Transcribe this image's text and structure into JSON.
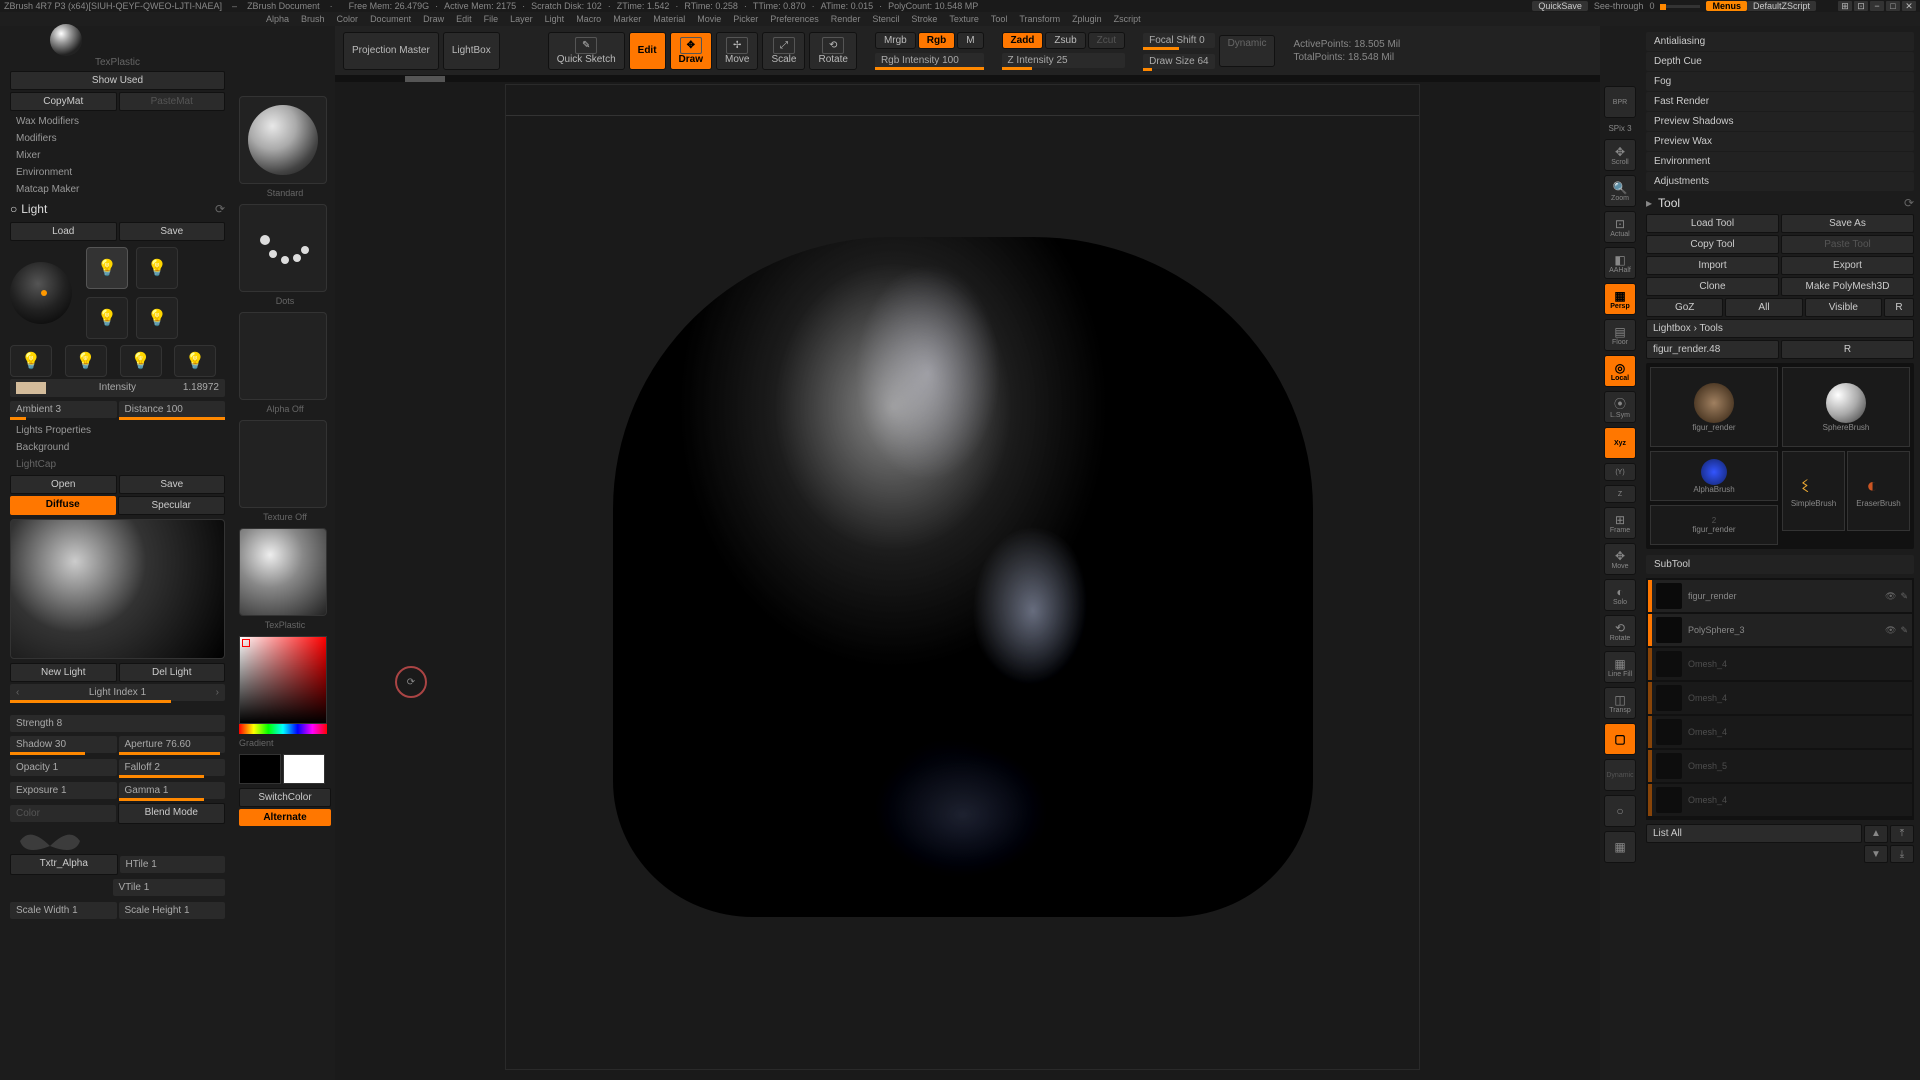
{
  "titlebar": {
    "app": "ZBrush 4R7 P3 (x64)[SIUH-QEYF-QWEO-LJTI-NAEA]",
    "doc": "ZBrush Document",
    "freemem": "Free Mem: 26.479G",
    "activemem": "Active Mem: 2175",
    "scratch": "Scratch Disk: 102",
    "ztime": "ZTime: 1.542",
    "rtime": "RTime: 0.258",
    "ttime": "TTime: 0.870",
    "atime": "ATime: 0.015",
    "polycount": "PolyCount: 10.548 MP",
    "quicksave": "QuickSave",
    "seethrough": "See-through",
    "seethrough_val": "0",
    "menus": "Menus",
    "script": "DefaultZScript"
  },
  "menubar": [
    "Alpha",
    "Brush",
    "Color",
    "Document",
    "Draw",
    "Edit",
    "File",
    "Layer",
    "Light",
    "Macro",
    "Marker",
    "Material",
    "Movie",
    "Picker",
    "Preferences",
    "Render",
    "Stencil",
    "Stroke",
    "Texture",
    "Tool",
    "Transform",
    "Zplugin",
    "Zscript"
  ],
  "left": {
    "texplastic": "TexPlastic",
    "show_used": "Show Used",
    "copymat": "CopyMat",
    "pastemat": "PasteMat",
    "wax": "Wax Modifiers",
    "modifiers": "Modifiers",
    "mixer": "Mixer",
    "environment": "Environment",
    "matcap": "Matcap Maker",
    "light": "Light",
    "load": "Load",
    "save": "Save",
    "intensity_label": "Intensity",
    "intensity_val": "1.18972",
    "ambient": "Ambient 3",
    "distance": "Distance 100",
    "lights_props": "Lights Properties",
    "background": "Background",
    "lightcap": "LightCap",
    "open": "Open",
    "diffuse": "Diffuse",
    "specular": "Specular",
    "new_light": "New Light",
    "del_light": "Del Light",
    "light_index": "Light Index 1",
    "strength": "Strength 8",
    "shadow": "Shadow 30",
    "aperture": "Aperture 76.60",
    "opacity": "Opacity 1",
    "falloff": "Falloff 2",
    "exposure": "Exposure 1",
    "gamma": "Gamma 1",
    "blend": "Blend Mode",
    "txtr_alpha": "Txtr_Alpha",
    "htile": "HTile 1",
    "vtile": "VTile 1",
    "scalew": "Scale Width 1",
    "scaleh": "Scale Height 1"
  },
  "toolcol": {
    "standard": "Standard",
    "dots": "Dots",
    "alpha_off": "Alpha Off",
    "texture_off": "Texture Off",
    "texplastic": "TexPlastic",
    "gradient": "Gradient",
    "switch": "SwitchColor",
    "alternate": "Alternate"
  },
  "toolbar": {
    "projection": "Projection Master",
    "lightbox": "LightBox",
    "quick": "Quick Sketch",
    "edit": "Edit",
    "draw": "Draw",
    "move": "Move",
    "scale": "Scale",
    "rotate": "Rotate",
    "mrgb": "Mrgb",
    "rgb": "Rgb",
    "m": "M",
    "rgb_intensity": "Rgb Intensity 100",
    "zadd": "Zadd",
    "zsub": "Zsub",
    "zcut": "Zcut",
    "z_intensity": "Z Intensity 25",
    "focal": "Focal Shift 0",
    "draw_size": "Draw Size 64",
    "dynamic": "Dynamic",
    "active_pts": "ActivePoints:",
    "active_val": "18.505 Mil",
    "total_pts": "TotalPoints:",
    "total_val": "18.548 Mil"
  },
  "right_icons": {
    "bpr": "BPR",
    "spix": "SPix 3",
    "scroll": "Scroll",
    "zoom": "Zoom",
    "actual": "Actual",
    "aahalf": "AAHalf",
    "persp": "Persp",
    "floor": "Floor",
    "local": "Local",
    "lf": "L.Sym",
    "xyz": "Xyz",
    "frame": "Frame",
    "move": "Move",
    "solo": "Solo",
    "rotate": "Rotate",
    "linefill": "Line Fill",
    "transp": "Transp",
    "dynamic": "Dynamic"
  },
  "right": {
    "antialiasing": "Antialiasing",
    "depthcue": "Depth Cue",
    "fog": "Fog",
    "fastrender": "Fast Render",
    "previewshadows": "Preview Shadows",
    "previewwax": "Preview Wax",
    "environment": "Environment",
    "adjustments": "Adjustments",
    "tool": "Tool",
    "load_tool": "Load Tool",
    "save_as": "Save As",
    "copy_tool": "Copy Tool",
    "paste_tool": "Paste Tool",
    "import": "Import",
    "export": "Export",
    "clone": "Clone",
    "make_poly": "Make PolyMesh3D",
    "goz": "GoZ",
    "all": "All",
    "visible": "Visible",
    "r": "R",
    "lightbox_tools": "Lightbox › Tools",
    "tool_name": "figur_render.48",
    "thumbs": {
      "figur": "figur_render",
      "sphere": "SphereBrush",
      "alpha": "AlphaBrush",
      "simple": "SimpleBrush",
      "eraser": "EraserBrush",
      "figur2": "figur_render"
    },
    "subtool": "SubTool",
    "sub_items": [
      "figur_render",
      "PolySphere_3",
      "Omesh_4",
      "Omesh_4",
      "Omesh_4",
      "Omesh_5",
      "Omesh_4"
    ],
    "list_all": "List All"
  }
}
